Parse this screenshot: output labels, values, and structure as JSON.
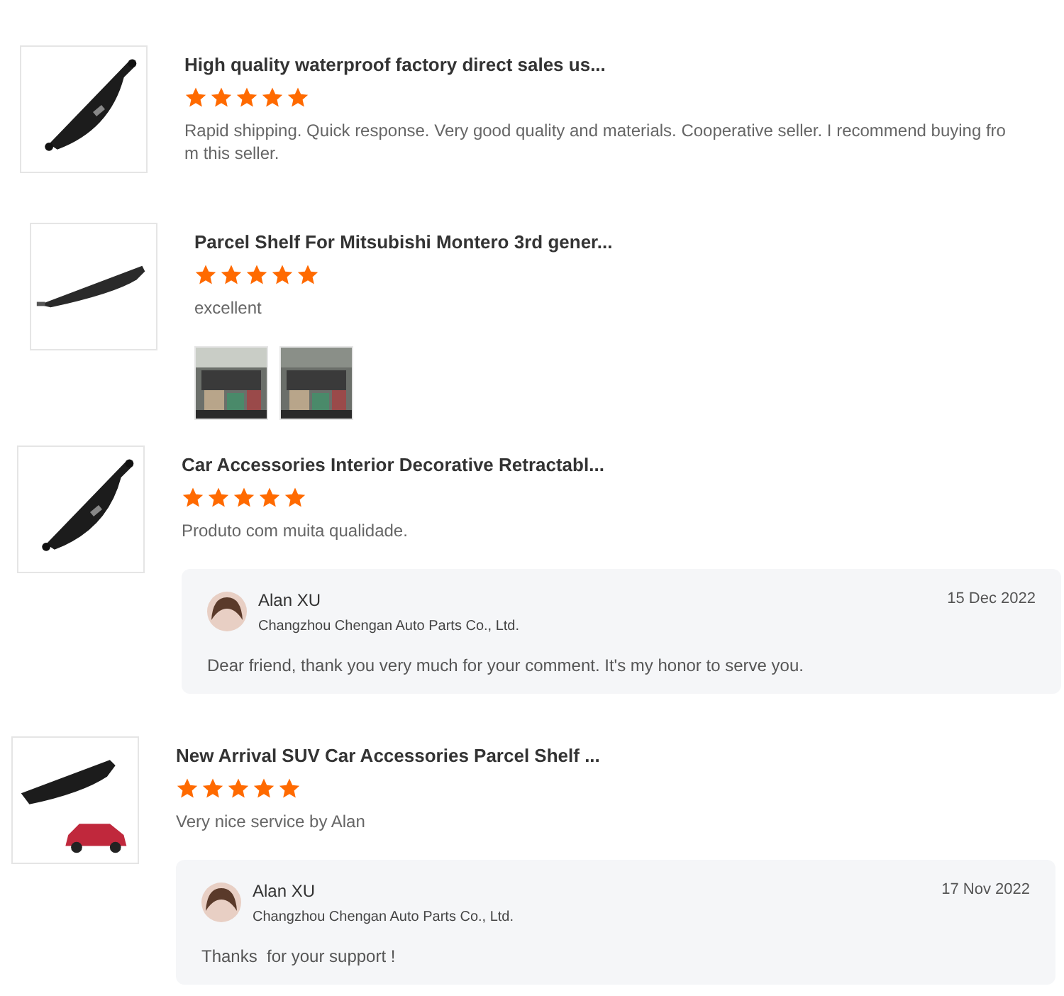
{
  "reviews": [
    {
      "title": "High quality waterproof factory direct sales us...",
      "stars": 5,
      "comment": "Rapid shipping. Quick response. Very good quality and materials. Cooperative seller. I recommend buying from this seller.",
      "product_image": {
        "kind": "picture"
      }
    },
    {
      "title": "Parcel Shelf For Mitsubishi Montero 3rd gener...",
      "stars": 5,
      "comment": "excellent",
      "product_image": {
        "kind": "picture"
      },
      "photos": [
        {
          "kind": "picture"
        },
        {
          "kind": "picture"
        }
      ]
    },
    {
      "title": "Car Accessories Interior Decorative Retractabl...",
      "stars": 5,
      "comment": "Produto com muita qualidade.",
      "product_image": {
        "kind": "picture"
      },
      "reply": {
        "name": "Alan XU",
        "company": "Changzhou Chengan Auto Parts Co., Ltd.",
        "date": "15 Dec 2022",
        "text": "Dear friend, thank you very much for your comment. It's my honor to serve you."
      }
    },
    {
      "title": "New Arrival SUV Car Accessories Parcel Shelf ...",
      "stars": 5,
      "comment": "Very nice service by Alan",
      "product_image": {
        "kind": "picture"
      },
      "reply": {
        "name": "Alan XU",
        "company": "Changzhou Chengan Auto Parts Co., Ltd.",
        "date": "17 Nov 2022",
        "text": "Thanks  for your support !"
      }
    }
  ]
}
